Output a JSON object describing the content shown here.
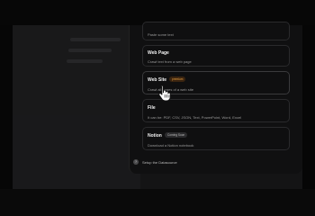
{
  "options": [
    {
      "title": "",
      "description": "Paste some text",
      "badge": ""
    },
    {
      "title": "Web Page",
      "description": "Crawl text from a web page",
      "badge": ""
    },
    {
      "title": "Web Site",
      "description": "Crawl all pages of a web site",
      "badge": "premium"
    },
    {
      "title": "File",
      "description": "It can be: PDF, CSV, JSON, Text, PowerPoint, Word, Excel",
      "badge": ""
    },
    {
      "title": "Notion",
      "description": "Download a Notion notebook",
      "badge": "Coming Soon"
    }
  ],
  "footer": {
    "label": "Setup the Datasource",
    "icon": "help-circle-icon"
  },
  "icons": {
    "cursor": "hand-pointer-icon"
  },
  "colors": {
    "premium_badge_bg": "#3a2410",
    "premium_badge_text": "#e8a040",
    "background": "#0c0c0d"
  }
}
